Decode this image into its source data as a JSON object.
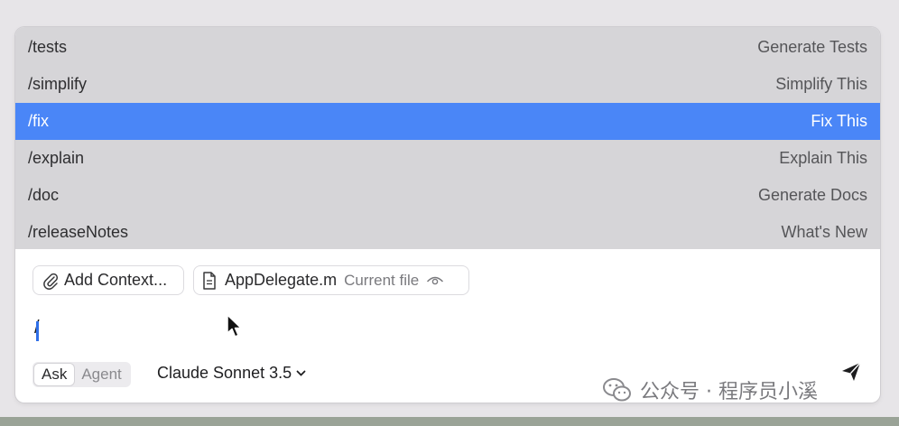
{
  "commands": [
    {
      "command": "/tests",
      "description": "Generate Tests",
      "selected": false
    },
    {
      "command": "/simplify",
      "description": "Simplify This",
      "selected": false
    },
    {
      "command": "/fix",
      "description": "Fix This",
      "selected": true
    },
    {
      "command": "/explain",
      "description": "Explain This",
      "selected": false
    },
    {
      "command": "/doc",
      "description": "Generate Docs",
      "selected": false
    },
    {
      "command": "/releaseNotes",
      "description": "What's New",
      "selected": false
    }
  ],
  "context": {
    "add_label": "Add Context...",
    "file_name": "AppDelegate.m",
    "file_note": "Current file"
  },
  "input": {
    "value": "/"
  },
  "mode": {
    "options": [
      "Ask",
      "Agent"
    ],
    "active": "Ask"
  },
  "model": {
    "name": "Claude Sonnet 3.5"
  },
  "watermark": {
    "text": "公众号 · 程序员小溪"
  },
  "colors": {
    "selection": "#4a86f7",
    "list_bg": "#d6d5d8"
  },
  "icons": {
    "attach": "paperclip-icon",
    "file": "document-icon",
    "visibility": "eye-icon",
    "send": "paper-plane-icon",
    "model_dropdown": "chevron-down-icon",
    "watermark": "wechat-icon"
  }
}
